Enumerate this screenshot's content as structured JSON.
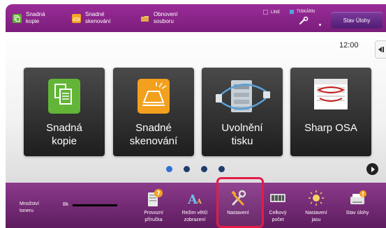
{
  "topbar": {
    "shortcuts": [
      {
        "label": "Snadná\nkopie",
        "icon": "copy-icon",
        "color": "#5fb133"
      },
      {
        "label": "Snadné\nskenování",
        "icon": "scan-icon",
        "color": "#f5a623"
      },
      {
        "label": "Obnovení\nsouboru",
        "icon": "folder-icon",
        "color": "#f0c36a"
      }
    ],
    "line_label": "LINE",
    "printer_label": "TISKÁRN",
    "job_status": "Stav Úlohy"
  },
  "main": {
    "clock": "12:00",
    "tiles": [
      {
        "label": "Snadná\nkopie",
        "icon": "copy-icon",
        "color": "#62b536"
      },
      {
        "label": "Snadné\nskenování",
        "icon": "scan-icon",
        "color": "#f2a01e"
      },
      {
        "label": "Uvolnění\ntisku",
        "icon": "print-release-icon",
        "color": "#9aa7b3"
      },
      {
        "label": "Sharp OSA",
        "icon": "sharp-osa-icon",
        "color": "#c81e1e"
      }
    ],
    "pages": {
      "count": 4,
      "current": 1
    }
  },
  "bottom": {
    "toner_label": "Množství\ntoneru",
    "toner_bk": "Bk",
    "items": [
      {
        "label": "Provozní\npříručka",
        "icon": "manual-icon"
      },
      {
        "label": "Režim větší\nzobrazení",
        "icon": "large-text-icon"
      },
      {
        "label": "Nastavení",
        "icon": "settings-icon"
      },
      {
        "label": "Celkový\npočet",
        "icon": "counter-icon"
      },
      {
        "label": "Nastavení\njasu",
        "icon": "brightness-icon"
      },
      {
        "label": "Stav úlohy",
        "icon": "job-status-icon"
      }
    ]
  },
  "colors": {
    "accent": "#8b2d8b",
    "highlight": "#e11d48",
    "pager_active": "#2f6fd6",
    "pager_inactive": "#1f3d6b"
  }
}
